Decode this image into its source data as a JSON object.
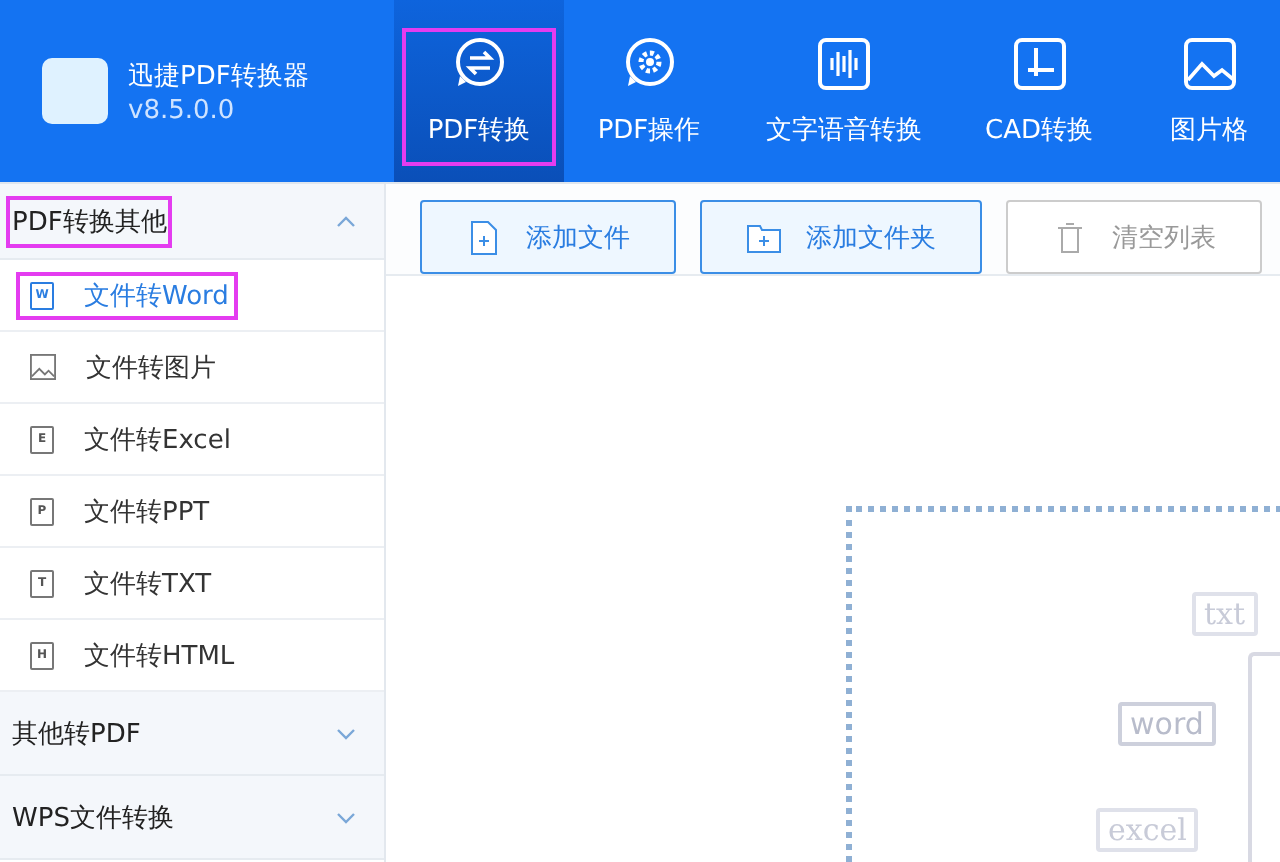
{
  "app": {
    "name": "迅捷PDF转换器",
    "version": "v8.5.0.0"
  },
  "tabs": [
    {
      "label": "PDF转换",
      "kind": "convert",
      "selected": true,
      "highlighted": true
    },
    {
      "label": "PDF操作",
      "kind": "gear",
      "selected": false,
      "highlighted": false
    },
    {
      "label": "文字语音转换",
      "kind": "wave",
      "selected": false,
      "highlighted": false
    },
    {
      "label": "CAD转换",
      "kind": "cad",
      "selected": false,
      "highlighted": false
    },
    {
      "label": "图片格",
      "kind": "image",
      "selected": false,
      "highlighted": false
    }
  ],
  "sidebar": {
    "groups": [
      {
        "label": "PDF转换其他",
        "expanded": true,
        "highlighted": true,
        "children": [
          {
            "label": "文件转Word",
            "kind": "doc",
            "icon_text": "W",
            "selected": true,
            "highlighted": true
          },
          {
            "label": "文件转图片",
            "kind": "image",
            "selected": false,
            "highlighted": false
          },
          {
            "label": "文件转Excel",
            "kind": "doc",
            "icon_text": "E",
            "selected": false,
            "highlighted": false
          },
          {
            "label": "文件转PPT",
            "kind": "doc",
            "icon_text": "P",
            "selected": false,
            "highlighted": false
          },
          {
            "label": "文件转TXT",
            "kind": "doc",
            "icon_text": "T",
            "selected": false,
            "highlighted": false
          },
          {
            "label": "文件转HTML",
            "kind": "doc",
            "icon_text": "H",
            "selected": false,
            "highlighted": false
          }
        ]
      },
      {
        "label": "其他转PDF",
        "expanded": false,
        "highlighted": false
      },
      {
        "label": "WPS文件转换",
        "expanded": false,
        "highlighted": false
      }
    ]
  },
  "toolbar": [
    {
      "label": "添加文件",
      "kind": "file",
      "disabled": false
    },
    {
      "label": "添加文件夹",
      "kind": "folder",
      "disabled": false
    },
    {
      "label": "清空列表",
      "kind": "trash",
      "disabled": true
    }
  ],
  "drop_area": {
    "tags": [
      "txt",
      "word",
      "excel"
    ]
  }
}
